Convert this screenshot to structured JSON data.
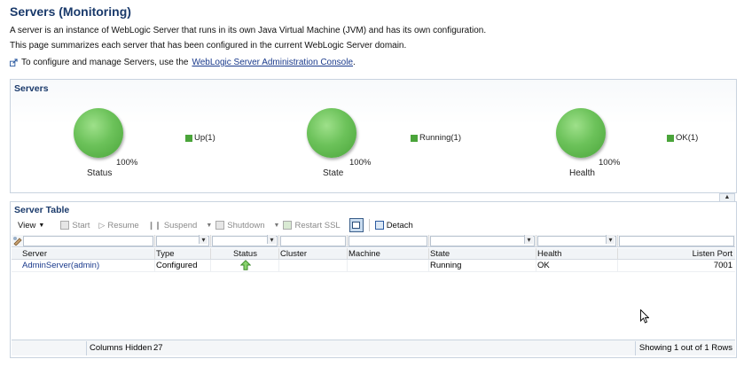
{
  "page": {
    "title": "Servers (Monitoring)",
    "intro1": "A server is an instance of WebLogic Server that runs in its own Java Virtual Machine (JVM) and has its own configuration.",
    "intro2": "This page summarizes each server that has been configured in the current WebLogic Server domain.",
    "intro3_prefix": "To configure and manage Servers, use the",
    "intro3_link": "WebLogic Server Administration Console",
    "intro3_suffix": "."
  },
  "servers_panel": {
    "title": "Servers",
    "gauges": [
      {
        "label": "Status",
        "percent": "100%",
        "legend": "Up(1)"
      },
      {
        "label": "State",
        "percent": "100%",
        "legend": "Running(1)"
      },
      {
        "label": "Health",
        "percent": "100%",
        "legend": "OK(1)"
      }
    ],
    "gauge_color": "#4aa43a"
  },
  "server_table": {
    "title": "Server Table",
    "toolbar": {
      "view": "View",
      "start": "Start",
      "resume": "Resume",
      "suspend": "Suspend",
      "shutdown": "Shutdown",
      "restart_ssl": "Restart SSL",
      "detach": "Detach"
    },
    "columns": [
      "Server",
      "Type",
      "Status",
      "Cluster",
      "Machine",
      "State",
      "Health",
      "Listen Port"
    ],
    "rows": [
      {
        "server": "AdminServer(admin)",
        "type": "Configured",
        "status_icon": "up-arrow-icon",
        "cluster": "",
        "machine": "",
        "state": "Running",
        "health": "OK",
        "listen_port": "7001"
      }
    ],
    "footer": {
      "columns_hidden_label": "Columns Hidden",
      "columns_hidden_count": "27",
      "showing": "Showing 1 out of 1 Rows"
    }
  }
}
